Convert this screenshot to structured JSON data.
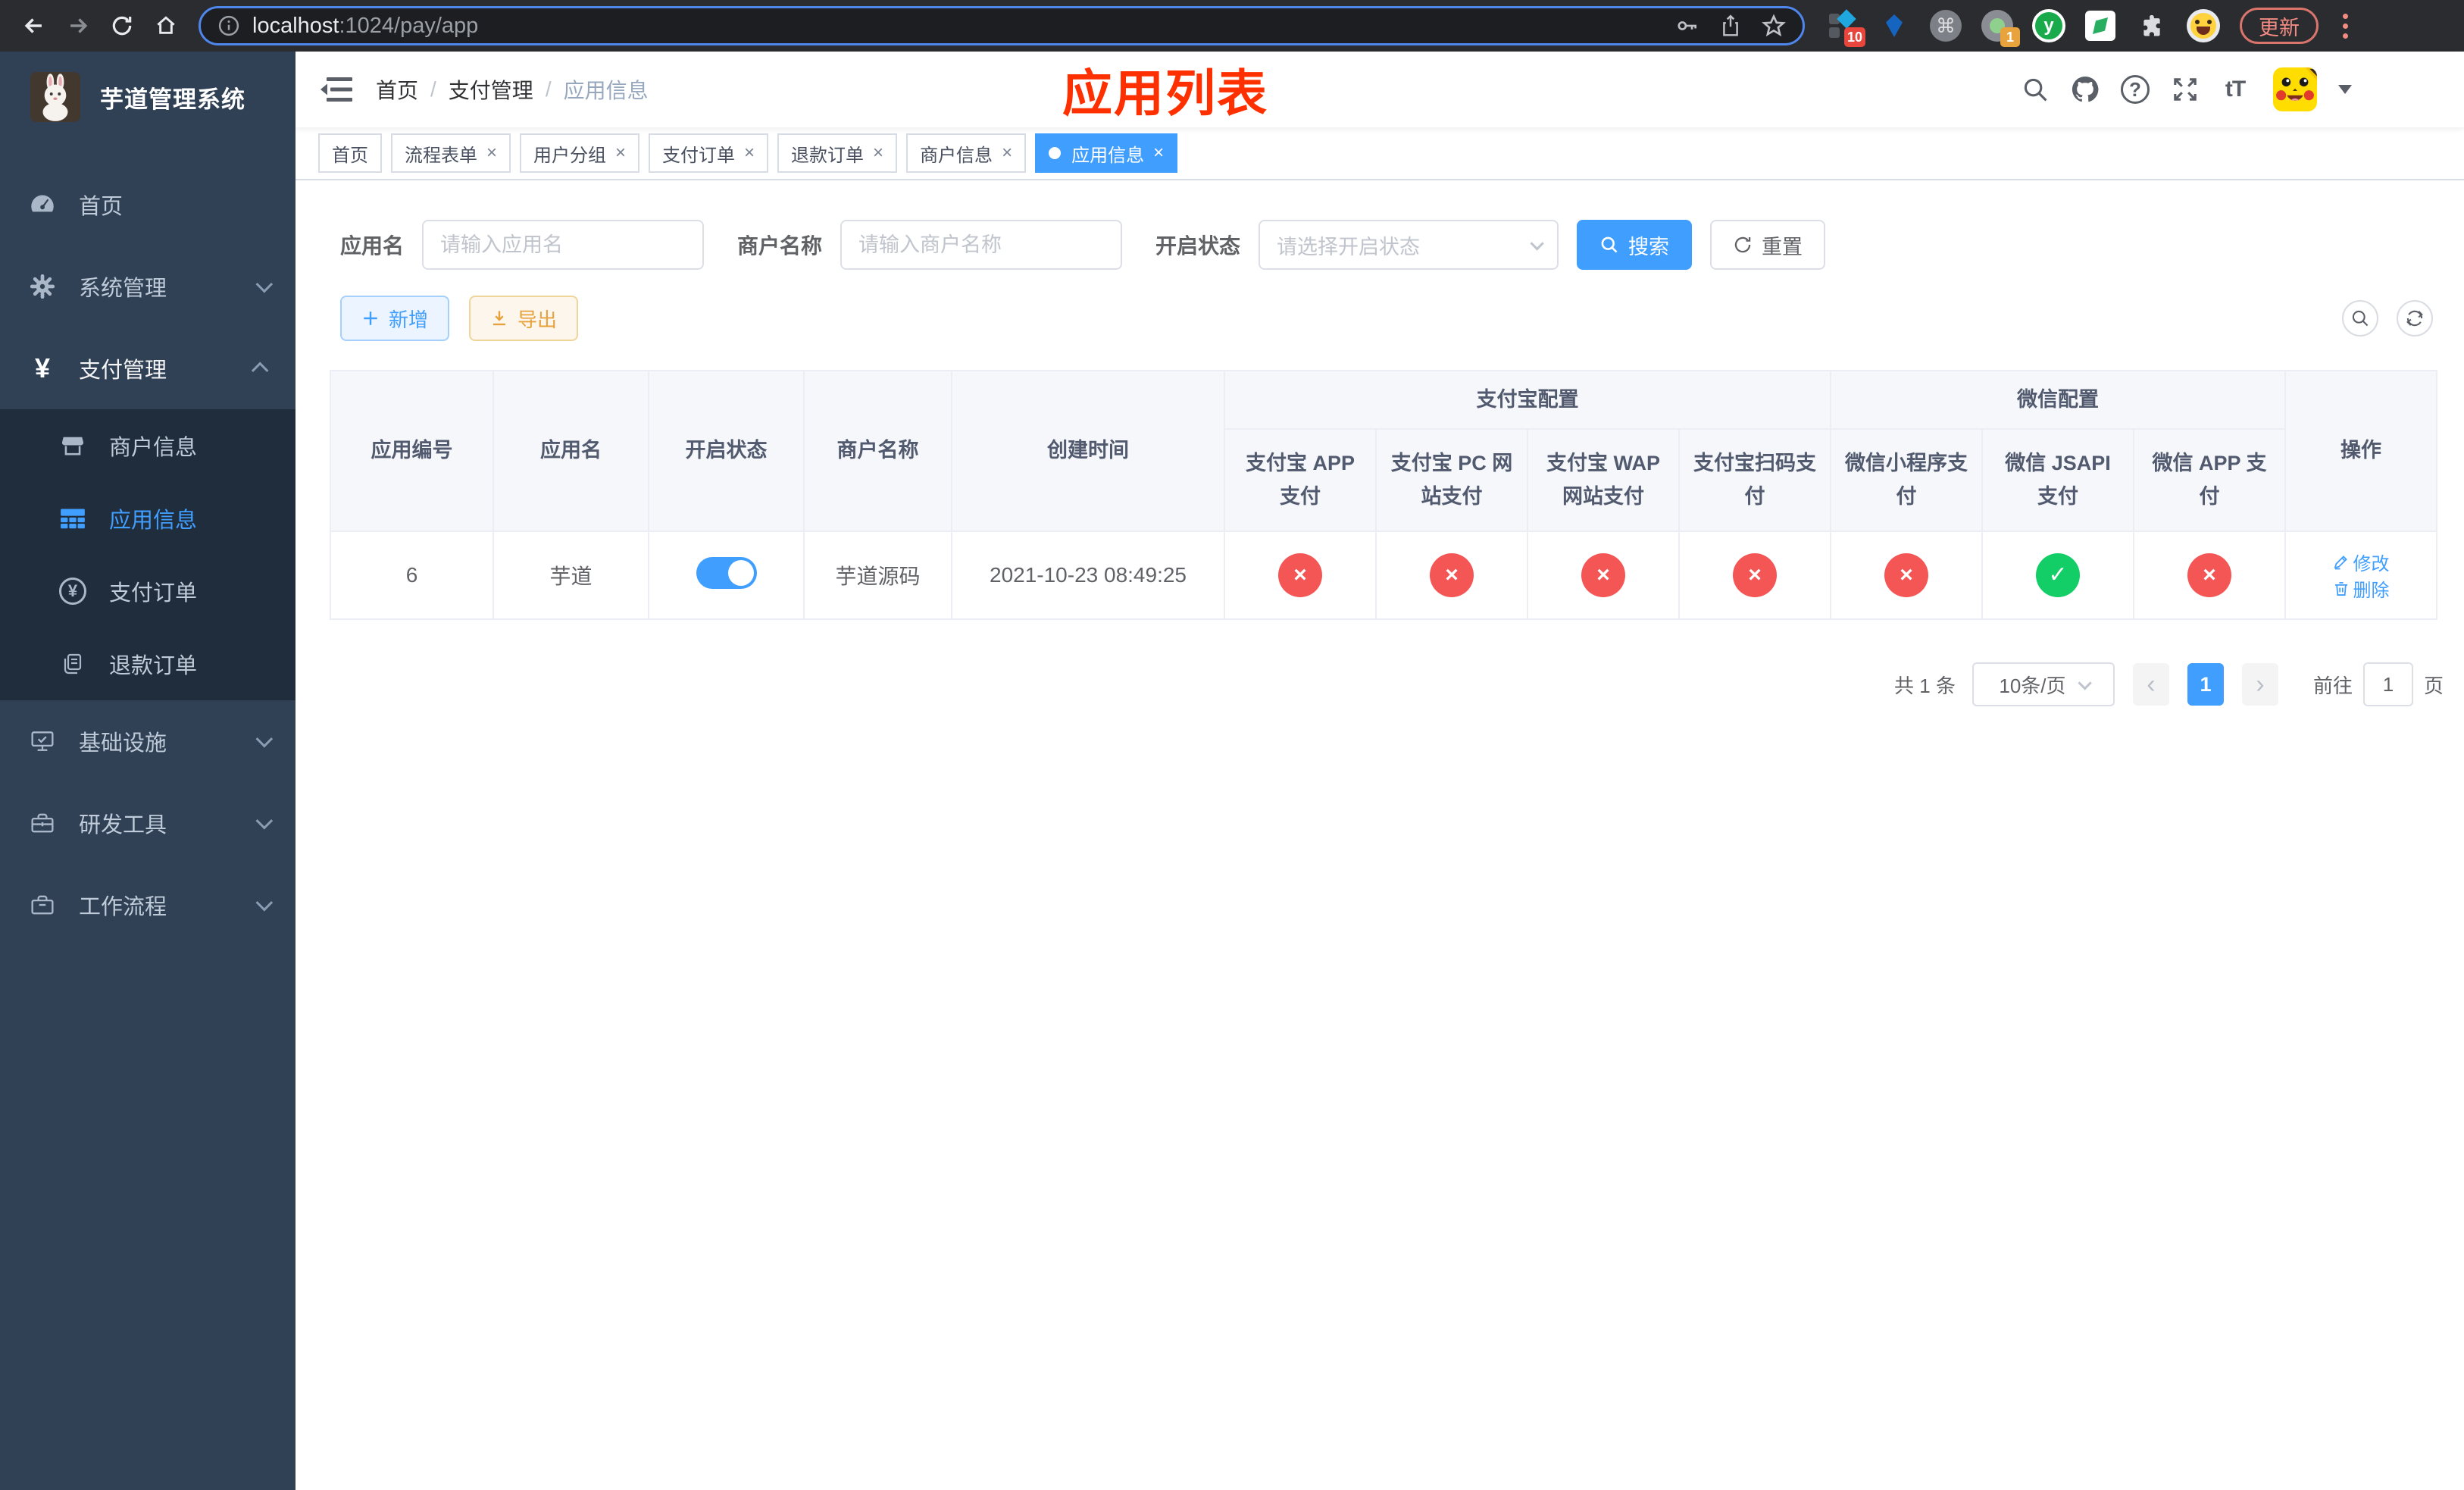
{
  "browser": {
    "url_host": "localhost",
    "url_path": ":1024/pay/app",
    "update_label": "更新",
    "badges": {
      "tampermonkey": "10",
      "proxy": "1"
    }
  },
  "icons": {
    "close": "×",
    "yen": "¥",
    "command": "⌘",
    "question": "?",
    "font_size": "tT",
    "letter_y": "y",
    "caret_prev": "‹",
    "caret_next": "›"
  },
  "sidebar": {
    "title": "芋道管理系统",
    "items": [
      {
        "icon": "dashboard-icon",
        "label": "首页"
      },
      {
        "icon": "gear-icon",
        "label": "系统管理"
      },
      {
        "icon": "yen-icon",
        "label": "支付管理"
      },
      {
        "icon": "store-icon",
        "label": "商户信息"
      },
      {
        "icon": "grid-icon",
        "label": "应用信息"
      },
      {
        "icon": "yen-circle-icon",
        "label": "支付订单"
      },
      {
        "icon": "documents-icon",
        "label": "退款订单"
      },
      {
        "icon": "monitor-icon",
        "label": "基础设施"
      },
      {
        "icon": "toolbox-icon",
        "label": "研发工具"
      },
      {
        "icon": "briefcase-icon",
        "label": "工作流程"
      }
    ]
  },
  "breadcrumb": {
    "separator": "/",
    "items": [
      {
        "label": "首页"
      },
      {
        "label": "支付管理"
      },
      {
        "label": "应用信息"
      }
    ]
  },
  "annotation": {
    "text": "应用列表",
    "color": "#ff3000"
  },
  "tabs": [
    {
      "label": "首页",
      "closable": false,
      "active": false
    },
    {
      "label": "流程表单",
      "closable": true,
      "active": false
    },
    {
      "label": "用户分组",
      "closable": true,
      "active": false
    },
    {
      "label": "支付订单",
      "closable": true,
      "active": false
    },
    {
      "label": "退款订单",
      "closable": true,
      "active": false
    },
    {
      "label": "商户信息",
      "closable": true,
      "active": false
    },
    {
      "label": "应用信息",
      "closable": true,
      "active": true
    }
  ],
  "filters": {
    "app_name_label": "应用名",
    "app_name_placeholder": "请输入应用名",
    "merchant_label": "商户名称",
    "merchant_placeholder": "请输入商户名称",
    "status_label": "开启状态",
    "status_placeholder": "请选择开启状态",
    "search_label": "搜索",
    "reset_label": "重置"
  },
  "toolbar": {
    "add_label": "新增",
    "export_label": "导出"
  },
  "table": {
    "columns": [
      "应用编号",
      "应用名",
      "开启状态",
      "商户名称",
      "创建时间"
    ],
    "group_alipay": {
      "label": "支付宝配置",
      "children": [
        "支付宝 APP 支付",
        "支付宝 PC 网站支付",
        "支付宝 WAP 网站支付",
        "支付宝扫码支付"
      ]
    },
    "group_wechat": {
      "label": "微信配置",
      "children": [
        "微信小程序支付",
        "微信 JSAPI 支付",
        "微信 APP 支付"
      ]
    },
    "actions_column": "操作",
    "row": {
      "id": "6",
      "app_name": "芋道",
      "enabled": true,
      "merchant_name": "芋道源码",
      "create_time": "2021-10-23 08:49:25",
      "statuses": [
        {
          "glyph": "×",
          "state": "off"
        },
        {
          "glyph": "×",
          "state": "off"
        },
        {
          "glyph": "×",
          "state": "off"
        },
        {
          "glyph": "×",
          "state": "off"
        },
        {
          "glyph": "×",
          "state": "off"
        },
        {
          "glyph": "✓",
          "state": "on"
        },
        {
          "glyph": "×",
          "state": "off"
        }
      ],
      "edit_label": "修改",
      "delete_label": "删除"
    }
  },
  "pagination": {
    "total": "共 1 条",
    "per_page": "10条/页",
    "page": "1",
    "goto_label": "前往",
    "goto_value": "1",
    "unit_label": "页"
  },
  "colors": {
    "primary": "#409EFF",
    "success": "#13ce66",
    "danger": "#f45656",
    "warning": "#E6A23C",
    "sidebar_bg": "#304156",
    "submenu_bg": "#1f2d3d",
    "annotation": "#ff3000"
  }
}
